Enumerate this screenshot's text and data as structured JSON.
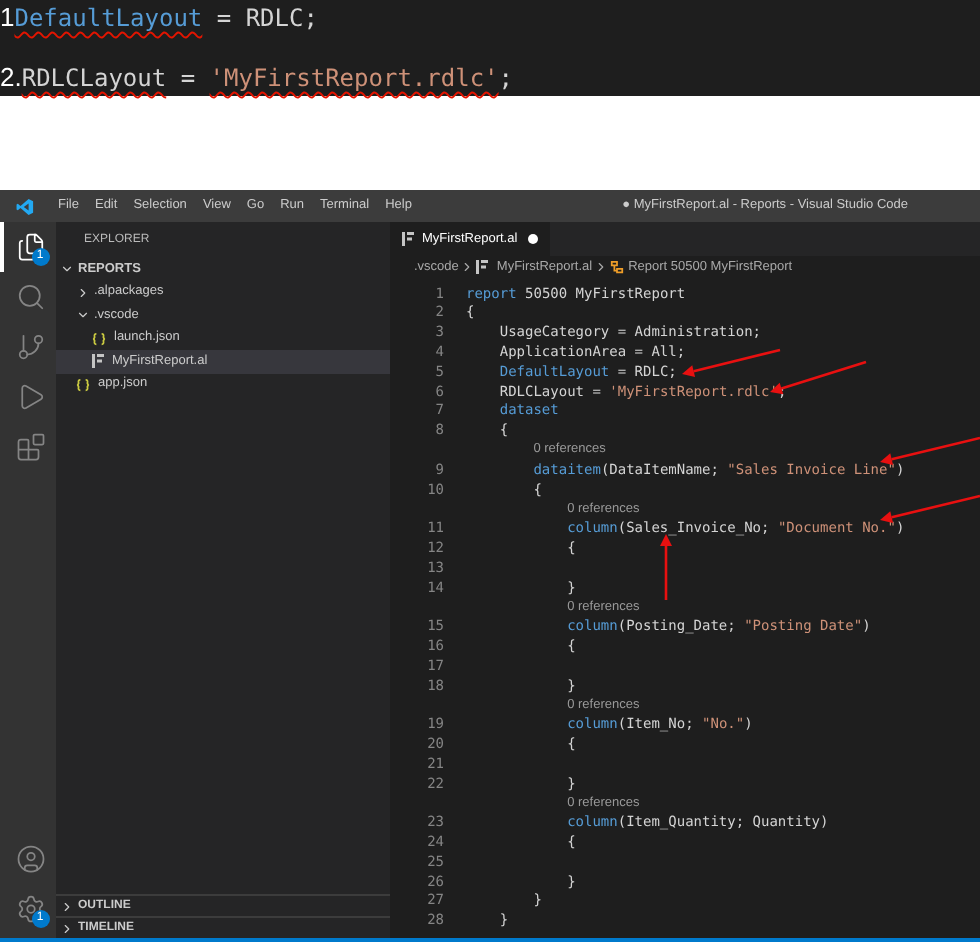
{
  "snippet": {
    "lines": [
      {
        "number": "1",
        "tokens": [
          {
            "text": "DefaultLayout",
            "kind": "property",
            "error": true
          },
          {
            "text": " = RDLC;",
            "kind": "plain",
            "error": false
          }
        ]
      },
      {
        "number": "2.",
        "tokens": [
          {
            "text": "RDLCLayout",
            "kind": "plain",
            "error": true
          },
          {
            "text": " = ",
            "kind": "plain",
            "error": false
          },
          {
            "text": "'MyFirstReport.rdlc'",
            "kind": "string",
            "error": true
          },
          {
            "text": ";",
            "kind": "plain",
            "error": false
          }
        ]
      }
    ]
  },
  "window": {
    "title": "● MyFirstReport.al - Reports - Visual Studio Code",
    "menu": [
      "File",
      "Edit",
      "Selection",
      "View",
      "Go",
      "Run",
      "Terminal",
      "Help"
    ]
  },
  "activity_bar": {
    "top": [
      {
        "kind": "files",
        "selected": true,
        "badge": "1"
      },
      {
        "kind": "search",
        "selected": false
      },
      {
        "kind": "source-control",
        "selected": false
      },
      {
        "kind": "run",
        "selected": false
      },
      {
        "kind": "extensions",
        "selected": false
      }
    ],
    "bottom": [
      {
        "kind": "account"
      },
      {
        "kind": "settings",
        "badge": "1"
      }
    ]
  },
  "sidebar": {
    "title": "EXPLORER",
    "tree": [
      {
        "label": "REPORTS",
        "kind": "section",
        "expanded": true,
        "children": [
          {
            "label": ".alpackages",
            "kind": "folder",
            "expanded": false
          },
          {
            "label": ".vscode",
            "kind": "folder",
            "expanded": true,
            "children": [
              {
                "label": "launch.json",
                "kind": "json",
                "selected": false
              },
              {
                "label": "MyFirstReport.al",
                "kind": "al",
                "selected": true
              }
            ]
          },
          {
            "label": "app.json",
            "kind": "json",
            "selected": false
          }
        ]
      }
    ],
    "panels": [
      {
        "label": "OUTLINE",
        "expanded": false
      },
      {
        "label": "TIMELINE",
        "expanded": false
      }
    ]
  },
  "tabs": [
    {
      "label": "MyFirstReport.al",
      "selected": true,
      "modified": true
    }
  ],
  "breadcrumb": [
    {
      "text": ".vscode",
      "kind": "folder"
    },
    {
      "text": "MyFirstReport.al",
      "kind": "file"
    },
    {
      "text": "Report 50500 MyFirstReport",
      "kind": "symbol"
    }
  ],
  "code": [
    {
      "kind": "code",
      "number": "1",
      "tokens": [
        {
          "text": "report",
          "kind": "keyword"
        },
        {
          "text": " 50500 MyFirstReport",
          "kind": "plain"
        }
      ]
    },
    {
      "kind": "code",
      "number": "2",
      "tokens": [
        {
          "text": "{",
          "kind": "plain"
        }
      ]
    },
    {
      "kind": "code",
      "number": "3",
      "tokens": [
        {
          "text": "    UsageCategory = Administration;",
          "kind": "plain"
        }
      ]
    },
    {
      "kind": "code",
      "number": "4",
      "tokens": [
        {
          "text": "    ApplicationArea = All;",
          "kind": "plain"
        }
      ]
    },
    {
      "kind": "code",
      "number": "5",
      "tokens": [
        {
          "text": "    DefaultLayout",
          "kind": "keyword"
        },
        {
          "text": " = RDLC;",
          "kind": "plain"
        }
      ]
    },
    {
      "kind": "code",
      "number": "6",
      "tokens": [
        {
          "text": "    RDLCLayout = ",
          "kind": "plain"
        },
        {
          "text": "'MyFirstReport.rdlc'",
          "kind": "string"
        },
        {
          "text": ";",
          "kind": "plain"
        }
      ]
    },
    {
      "kind": "code",
      "number": "7",
      "tokens": [
        {
          "text": "    dataset",
          "kind": "keyword"
        }
      ]
    },
    {
      "kind": "code",
      "number": "8",
      "tokens": [
        {
          "text": "    {",
          "kind": "plain"
        }
      ]
    },
    {
      "kind": "refs",
      "text": "        0 references"
    },
    {
      "kind": "code",
      "number": "9",
      "tokens": [
        {
          "text": "        dataitem",
          "kind": "keyword"
        },
        {
          "text": "(DataItemName; ",
          "kind": "plain"
        },
        {
          "text": "\"Sales Invoice Line\"",
          "kind": "string"
        },
        {
          "text": ")",
          "kind": "plain"
        }
      ]
    },
    {
      "kind": "code",
      "number": "10",
      "tokens": [
        {
          "text": "        {",
          "kind": "plain"
        }
      ]
    },
    {
      "kind": "refs",
      "text": "            0 references"
    },
    {
      "kind": "code",
      "number": "11",
      "tokens": [
        {
          "text": "            column",
          "kind": "keyword"
        },
        {
          "text": "(Sales_Invoice_No; ",
          "kind": "plain"
        },
        {
          "text": "\"Document No.\"",
          "kind": "string"
        },
        {
          "text": ")",
          "kind": "plain"
        }
      ]
    },
    {
      "kind": "code",
      "number": "12",
      "tokens": [
        {
          "text": "            {",
          "kind": "plain"
        }
      ]
    },
    {
      "kind": "code",
      "number": "13"
    },
    {
      "kind": "code",
      "number": "14",
      "tokens": [
        {
          "text": "            }",
          "kind": "plain"
        }
      ]
    },
    {
      "kind": "refs",
      "text": "            0 references"
    },
    {
      "kind": "code",
      "number": "15",
      "tokens": [
        {
          "text": "            column",
          "kind": "keyword"
        },
        {
          "text": "(Posting_Date; ",
          "kind": "plain"
        },
        {
          "text": "\"Posting Date\"",
          "kind": "string"
        },
        {
          "text": ")",
          "kind": "plain"
        }
      ]
    },
    {
      "kind": "code",
      "number": "16",
      "tokens": [
        {
          "text": "            {",
          "kind": "plain"
        }
      ]
    },
    {
      "kind": "code",
      "number": "17"
    },
    {
      "kind": "code",
      "number": "18",
      "tokens": [
        {
          "text": "            }",
          "kind": "plain"
        }
      ]
    },
    {
      "kind": "refs",
      "text": "            0 references"
    },
    {
      "kind": "code",
      "number": "19",
      "tokens": [
        {
          "text": "            column",
          "kind": "keyword"
        },
        {
          "text": "(Item_No; ",
          "kind": "plain"
        },
        {
          "text": "\"No.\"",
          "kind": "string"
        },
        {
          "text": ")",
          "kind": "plain"
        }
      ]
    },
    {
      "kind": "code",
      "number": "20",
      "tokens": [
        {
          "text": "            {",
          "kind": "plain"
        }
      ]
    },
    {
      "kind": "code",
      "number": "21"
    },
    {
      "kind": "code",
      "number": "22",
      "tokens": [
        {
          "text": "            }",
          "kind": "plain"
        }
      ]
    },
    {
      "kind": "refs",
      "text": "            0 references"
    },
    {
      "kind": "code",
      "number": "23",
      "tokens": [
        {
          "text": "            column",
          "kind": "keyword"
        },
        {
          "text": "(Item_Quantity; Quantity)",
          "kind": "plain"
        }
      ]
    },
    {
      "kind": "code",
      "number": "24",
      "tokens": [
        {
          "text": "            {",
          "kind": "plain"
        }
      ]
    },
    {
      "kind": "code",
      "number": "25"
    },
    {
      "kind": "code",
      "number": "26",
      "tokens": [
        {
          "text": "            }",
          "kind": "plain"
        }
      ]
    },
    {
      "kind": "code",
      "number": "27",
      "tokens": [
        {
          "text": "        }",
          "kind": "plain"
        }
      ]
    },
    {
      "kind": "code",
      "number": "28",
      "tokens": [
        {
          "text": "    }",
          "kind": "plain"
        }
      ]
    }
  ]
}
